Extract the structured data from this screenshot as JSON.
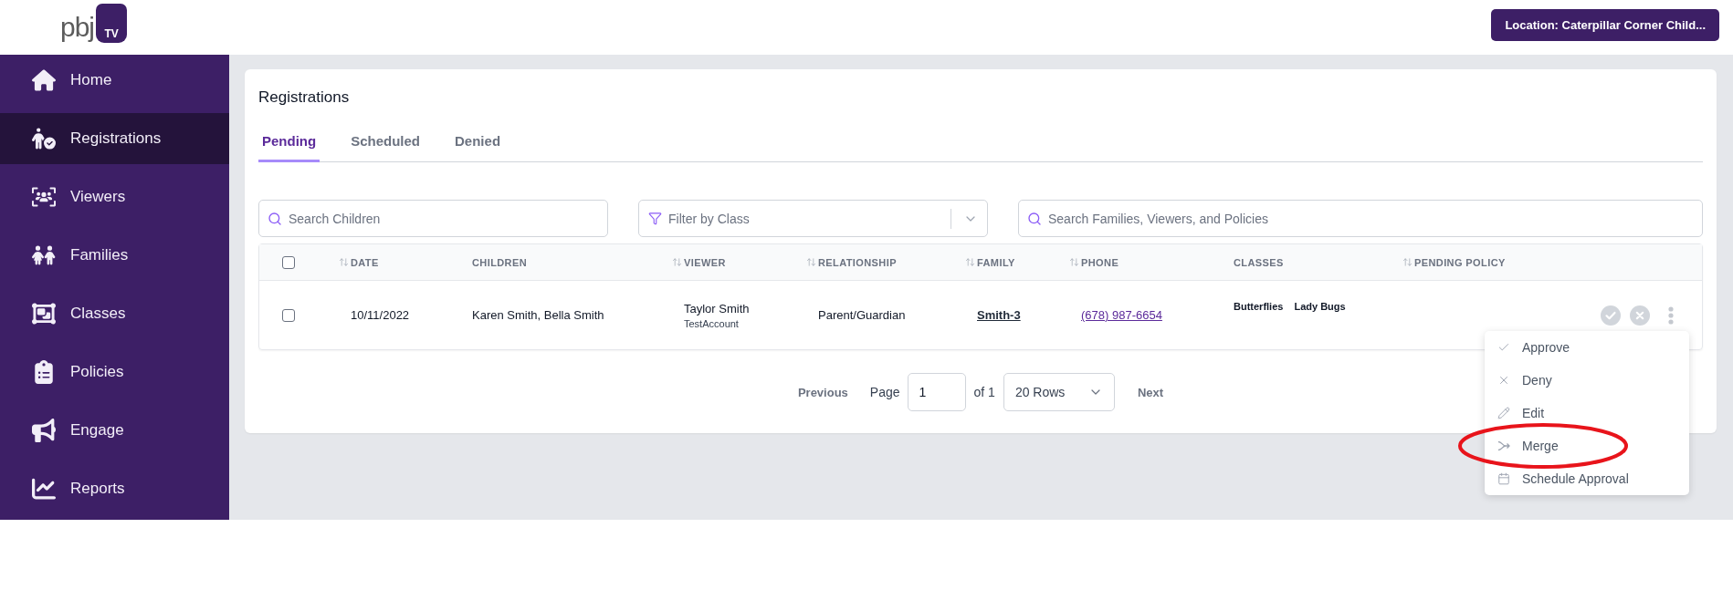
{
  "header": {
    "logo": {
      "wordmark": "pbj",
      "badge": "TV"
    },
    "location_button": "Location: Caterpillar Corner Child..."
  },
  "sidebar": {
    "items": [
      {
        "label": "Home",
        "selected": false
      },
      {
        "label": "Registrations",
        "selected": true
      },
      {
        "label": "Viewers",
        "selected": false
      },
      {
        "label": "Families",
        "selected": false
      },
      {
        "label": "Classes",
        "selected": false
      },
      {
        "label": "Policies",
        "selected": false
      },
      {
        "label": "Engage",
        "selected": false
      },
      {
        "label": "Reports",
        "selected": false
      }
    ]
  },
  "page": {
    "title": "Registrations",
    "tabs": [
      {
        "label": "Pending",
        "selected": true
      },
      {
        "label": "Scheduled",
        "selected": false
      },
      {
        "label": "Denied",
        "selected": false
      }
    ],
    "filters": [
      {
        "kind": "search",
        "placeholder": "Search Children"
      },
      {
        "kind": "select",
        "placeholder": "Filter by Class"
      },
      {
        "kind": "search",
        "placeholder": "Search Families, Viewers, and Policies"
      }
    ],
    "table": {
      "select_all": {
        "checked": false
      },
      "columns": [
        {
          "label": "DATE",
          "sortable": true
        },
        {
          "label": "CHILDREN",
          "sortable": false
        },
        {
          "label": "VIEWER",
          "sortable": true
        },
        {
          "label": "RELATIONSHIP",
          "sortable": true
        },
        {
          "label": "FAMILY",
          "sortable": true
        },
        {
          "label": "PHONE",
          "sortable": true
        },
        {
          "label": "CLASSES",
          "sortable": false
        },
        {
          "label": "PENDING POLICY",
          "sortable": true
        }
      ],
      "rows": [
        {
          "checked": false,
          "date": "10/11/2022",
          "children": "Karen Smith, Bella Smith",
          "viewer": {
            "name": "Taylor Smith",
            "account": "TestAccount"
          },
          "relationship": "Parent/Guardian",
          "family": "Smith-3",
          "phone": "(678) 987-6654",
          "classes": [
            "Butterflies",
            "Lady Bugs"
          ],
          "menu": [
            {
              "label": "Approve",
              "highlighted": false
            },
            {
              "label": "Deny",
              "highlighted": false
            },
            {
              "label": "Edit",
              "highlighted": false
            },
            {
              "label": "Merge",
              "highlighted": true
            },
            {
              "label": "Schedule Approval",
              "highlighted": false
            }
          ]
        }
      ]
    },
    "pagination": {
      "previous": {
        "label": "Previous",
        "disabled": true
      },
      "page_label": "Page",
      "page_value": "1",
      "of_label": "of 1",
      "rows_select": "20 Rows",
      "next": {
        "label": "Next",
        "disabled": true
      }
    }
  }
}
